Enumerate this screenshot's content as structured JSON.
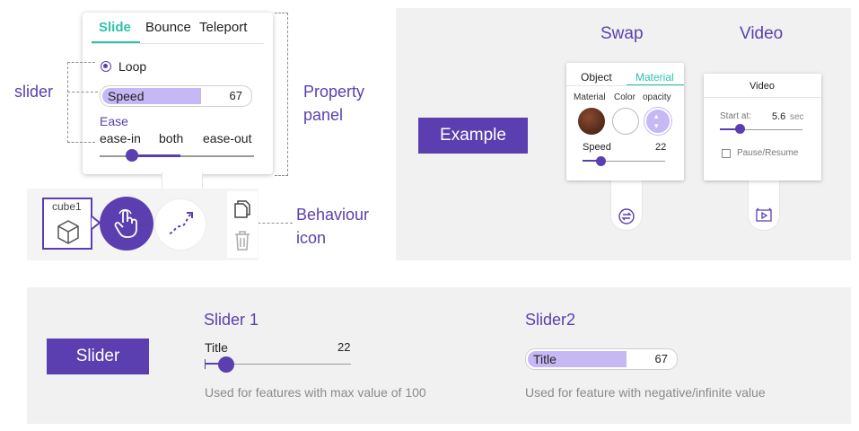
{
  "property_panel": {
    "tabs": [
      "Slide",
      "Bounce",
      "Teleport"
    ],
    "active_tab": "Slide",
    "loop_label": "Loop",
    "speed": {
      "label": "Speed",
      "value": "67",
      "fraction": 0.67
    },
    "ease": {
      "label": "Ease",
      "options": [
        "ease-in",
        "both",
        "ease-out"
      ],
      "selected": "both"
    }
  },
  "annotations": {
    "slider": "slider",
    "property_panel_line1": "Property",
    "property_panel_line2": "panel",
    "behaviour_icon_line1": "Behaviour",
    "behaviour_icon_line2": "icon"
  },
  "object_chip": {
    "label": "cube1",
    "icon": "cube-icon"
  },
  "behaviour_icons": {
    "hand": "touch-hand-icon",
    "behaviour": "slide-path-icon",
    "copy": "copy-icon",
    "delete": "trash-icon"
  },
  "example": {
    "badge": "Example",
    "swap": {
      "heading": "Swap",
      "tabs": [
        "Object",
        "Material"
      ],
      "active_tab": "Material",
      "columns": [
        "Material",
        "Color",
        "opacity"
      ],
      "speed_label": "Speed",
      "speed_value": "22",
      "speed_fraction": 0.22,
      "icon": "swap-icon"
    },
    "video": {
      "heading": "Video",
      "title": "Video",
      "start_label": "Start at:",
      "start_value": "5.6",
      "start_unit": "sec",
      "pause_label": "Pause/Resume",
      "icon": "video-icon"
    }
  },
  "slider_section": {
    "badge": "Slider",
    "slider1": {
      "heading": "Slider 1",
      "title": "Title",
      "value": "22",
      "fraction": 0.22,
      "description": "Used for features with max value of 100"
    },
    "slider2": {
      "heading": "Slider2",
      "title": "Title",
      "value": "67",
      "fraction": 0.67,
      "description": "Used for feature with negative/infinite value"
    }
  },
  "colors": {
    "accent": "#5b3fb0",
    "tab_active": "#2cc3a8",
    "fill_light": "#c5b8f5"
  }
}
